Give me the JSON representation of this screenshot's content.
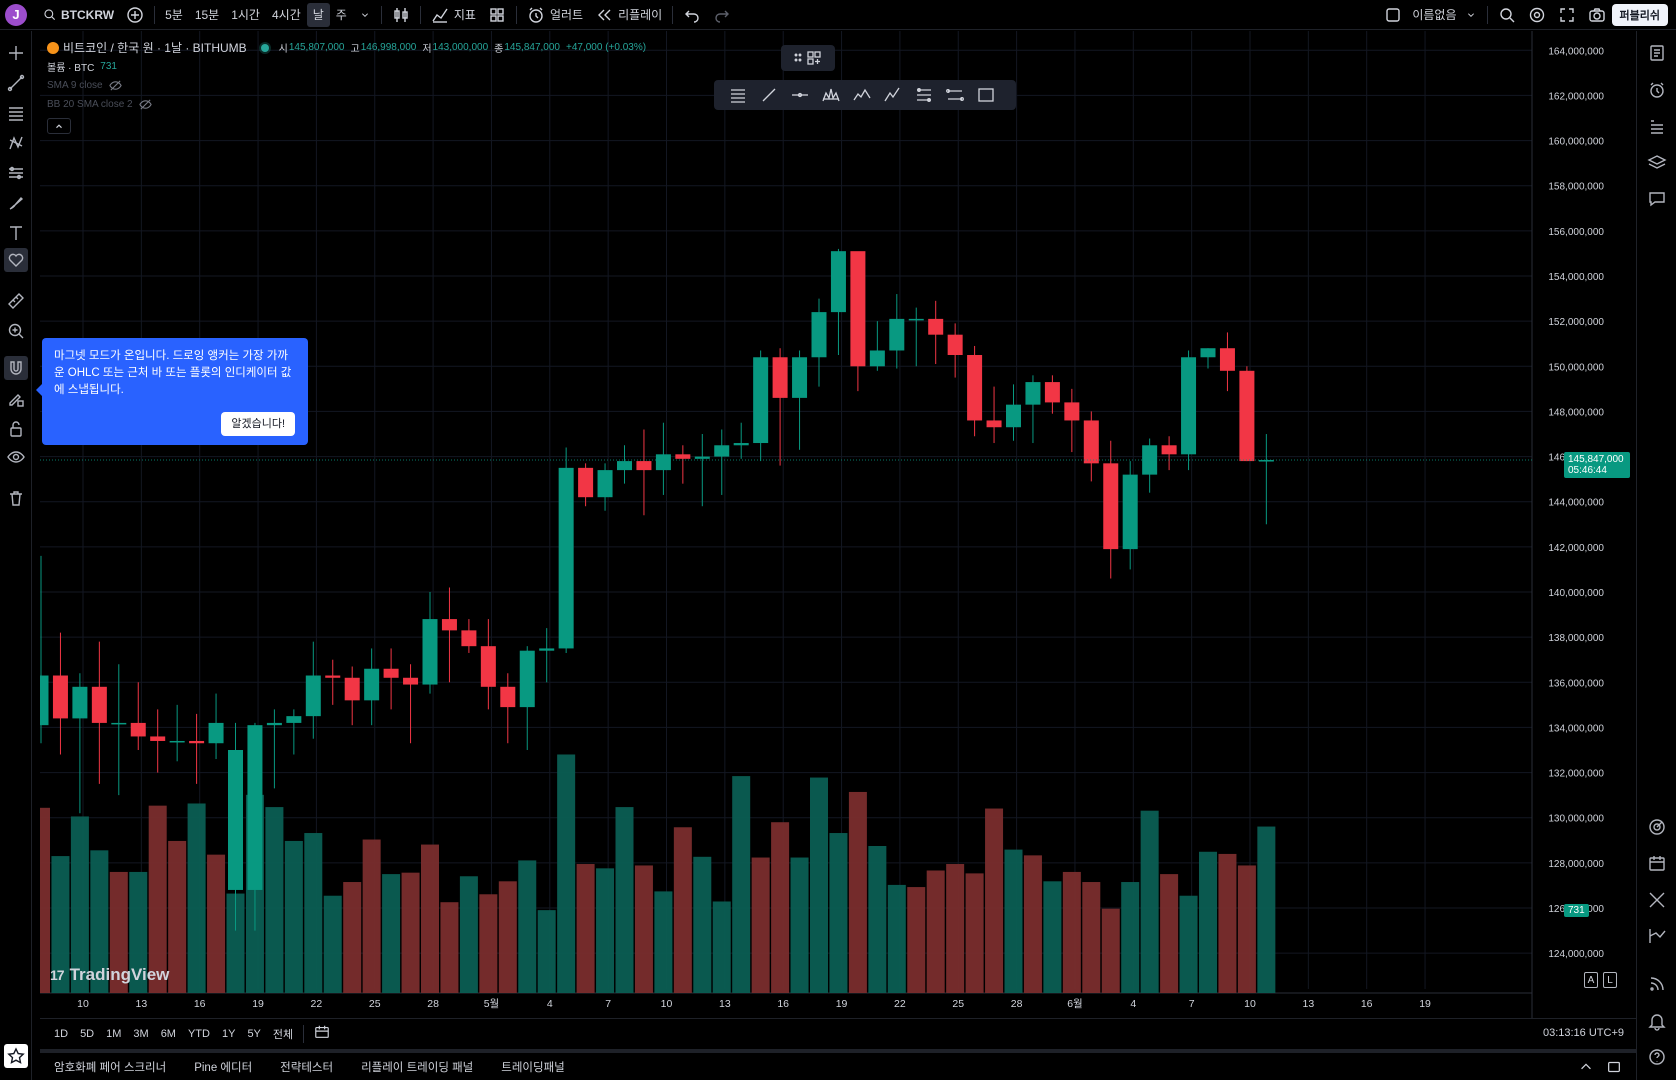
{
  "topbar": {
    "avatar_letter": "J",
    "symbol": "BTCKRW",
    "intervals": [
      "5분",
      "15분",
      "1시간",
      "4시간",
      "날",
      "주"
    ],
    "active_interval": "날",
    "indicators_label": "지표",
    "alert_label": "얼러트",
    "replay_label": "리플레이",
    "layout_name": "이름없음",
    "publish_label": "퍼블리쉬"
  },
  "legend": {
    "title": "비트코인 / 한국 원 · 1날 · BITHUMB",
    "o_label": "시",
    "o_val": "145,807,000",
    "h_label": "고",
    "h_val": "146,998,000",
    "l_label": "저",
    "l_val": "143,000,000",
    "c_label": "종",
    "c_val": "145,847,000",
    "change": "+47,000 (+0.03%)",
    "volume_label": "볼륨 · BTC",
    "volume_val": "731",
    "sma_label": "SMA 9 close",
    "bb_label": "BB 20 SMA close 2"
  },
  "tooltip": {
    "text": "마그넷 모드가 온입니다. 드로잉 앵커는 가장 가까운 OHLC 또는 근처 바 또는 플롯의 인디케이터 값에 스냅됩니다.",
    "button": "알겠습니다!"
  },
  "price_tag": {
    "price": "145,847,000",
    "countdown": "05:46:44"
  },
  "volume_tag": "731",
  "brand": "TradingView",
  "rangebar": {
    "ranges": [
      "1D",
      "5D",
      "1M",
      "3M",
      "6M",
      "YTD",
      "1Y",
      "5Y",
      "전체"
    ],
    "clock": "03:13:16 UTC+9"
  },
  "panels": [
    "암호화폐 페어 스크리너",
    "Pine 에디터",
    "전략테스터",
    "리플레이 트레이딩 패널",
    "트레이딩패널"
  ],
  "scale_buttons": [
    "A",
    "L"
  ],
  "colors": {
    "up": "#089981",
    "down": "#f23645",
    "vol_up": "#0b5e53",
    "vol_down": "#7a2d2d",
    "accent": "#2962ff"
  },
  "chart_data": {
    "type": "candlestick",
    "price_range": [
      122500000,
      164500000
    ],
    "price_ticks": [
      "164,000,000",
      "162,000,000",
      "160,000,000",
      "158,000,000",
      "156,000,000",
      "154,000,000",
      "152,000,000",
      "150,000,000",
      "148,000,000",
      "146,000,000",
      "144,000,000",
      "142,000,000",
      "140,000,000",
      "138,000,000",
      "136,000,000",
      "134,000,000",
      "132,000,000",
      "130,000,000",
      "128,000,000",
      "126,000,000",
      "124,000,000"
    ],
    "x_ticks": [
      "10",
      "13",
      "16",
      "19",
      "22",
      "25",
      "28",
      "5월",
      "4",
      "7",
      "10",
      "13",
      "16",
      "19",
      "22",
      "25",
      "28",
      "6월",
      "4",
      "7",
      "10",
      "13",
      "16",
      "19"
    ],
    "candles_ohlc": [
      [
        134100,
        141600,
        133300,
        136300
      ],
      [
        136300,
        138200,
        132800,
        134400
      ],
      [
        134400,
        136400,
        130200,
        135800
      ],
      [
        135800,
        137800,
        131500,
        134200
      ],
      [
        134200,
        136800,
        131000,
        134200
      ],
      [
        134200,
        136000,
        133000,
        133600
      ],
      [
        133600,
        134800,
        132000,
        133400
      ],
      [
        133400,
        135000,
        132500,
        133400
      ],
      [
        133400,
        134600,
        131500,
        133300
      ],
      [
        133300,
        135500,
        132600,
        134200
      ],
      [
        126800,
        134200,
        125000,
        133000
      ],
      [
        126800,
        134200,
        125000,
        134100
      ],
      [
        134100,
        134800,
        131300,
        134200
      ],
      [
        134200,
        134800,
        132800,
        134500
      ],
      [
        134500,
        137800,
        133500,
        136300
      ],
      [
        136300,
        137000,
        135000,
        136200
      ],
      [
        136200,
        136700,
        134100,
        135200
      ],
      [
        135200,
        137500,
        134100,
        136600
      ],
      [
        136600,
        137500,
        134800,
        136200
      ],
      [
        136200,
        136800,
        133300,
        135900
      ],
      [
        135900,
        140000,
        135500,
        138800
      ],
      [
        138800,
        140200,
        136000,
        138300
      ],
      [
        138300,
        138800,
        137300,
        137600
      ],
      [
        137600,
        138800,
        134800,
        135800
      ],
      [
        135800,
        136400,
        133300,
        134900
      ],
      [
        134900,
        137600,
        133000,
        137400
      ],
      [
        137400,
        138400,
        136000,
        137500
      ],
      [
        137500,
        146400,
        137300,
        145500
      ],
      [
        145500,
        145700,
        143800,
        144200
      ],
      [
        144200,
        145700,
        143600,
        145400
      ],
      [
        145400,
        146500,
        144800,
        145800
      ],
      [
        145800,
        147200,
        143400,
        145400
      ],
      [
        145400,
        147500,
        144300,
        146100
      ],
      [
        146100,
        146500,
        144800,
        145900
      ],
      [
        145900,
        147000,
        143800,
        146000
      ],
      [
        146000,
        147200,
        144300,
        146500
      ],
      [
        146500,
        147500,
        145900,
        146600
      ],
      [
        146600,
        150700,
        145800,
        150400
      ],
      [
        150400,
        150800,
        145600,
        148600
      ],
      [
        148600,
        150700,
        146300,
        150400
      ],
      [
        150400,
        153000,
        149100,
        152400
      ],
      [
        152400,
        155200,
        150500,
        155100
      ],
      [
        155100,
        155000,
        148900,
        150000
      ],
      [
        150000,
        152000,
        149800,
        150700
      ],
      [
        150700,
        153200,
        149900,
        152100
      ],
      [
        152100,
        152600,
        150000,
        152100
      ],
      [
        152100,
        152900,
        150100,
        151400
      ],
      [
        151400,
        151900,
        149500,
        150500
      ],
      [
        150500,
        150900,
        146900,
        147600
      ],
      [
        147600,
        149100,
        146600,
        147300
      ],
      [
        147300,
        149200,
        146700,
        148300
      ],
      [
        148300,
        149600,
        146600,
        149300
      ],
      [
        149300,
        149600,
        147900,
        148400
      ],
      [
        148400,
        149000,
        146200,
        147600
      ],
      [
        147600,
        148000,
        144900,
        145700
      ],
      [
        145700,
        146700,
        140600,
        141900
      ],
      [
        141900,
        145800,
        141000,
        145200
      ],
      [
        145200,
        146800,
        144400,
        146500
      ],
      [
        146500,
        146900,
        145400,
        146100
      ],
      [
        146100,
        150700,
        145400,
        150400
      ],
      [
        150400,
        150800,
        149900,
        150800
      ],
      [
        150800,
        151500,
        148900,
        149800
      ],
      [
        149800,
        150000,
        145800,
        145800
      ],
      [
        145800,
        146998,
        143000,
        145847
      ]
    ],
    "volumes": [
      2570,
      1900,
      2450,
      1980,
      1680,
      1680,
      2600,
      2110,
      2630,
      1920,
      1380,
      2750,
      2580,
      2110,
      2220,
      1350,
      1540,
      2130,
      1650,
      1670,
      2060,
      1260,
      1620,
      1370,
      1550,
      1840,
      1150,
      3310,
      1790,
      1730,
      2580,
      1770,
      1410,
      2300,
      1890,
      1270,
      3010,
      1880,
      2370,
      1880,
      2990,
      2220,
      2790,
      2040,
      1500,
      1470,
      1700,
      1790,
      1660,
      2560,
      1990,
      1910,
      1550,
      1680,
      1540,
      1170,
      1540,
      2530,
      1650,
      1350,
      1960,
      1930,
      1770,
      2310
    ],
    "volume_bars_up": [
      false,
      true,
      true,
      true,
      false,
      true,
      false,
      false,
      true,
      false,
      true,
      true,
      true,
      true,
      true,
      true,
      false,
      false,
      true,
      false,
      false,
      false,
      true,
      false,
      false,
      true,
      true,
      true,
      false,
      true,
      true,
      false,
      true,
      false,
      true,
      true,
      true,
      false,
      false,
      true,
      true,
      true,
      false,
      true,
      true,
      false,
      false,
      false,
      false,
      false,
      true,
      false,
      true,
      false,
      false,
      false,
      true,
      true,
      false,
      true,
      true,
      false,
      false,
      true
    ]
  }
}
